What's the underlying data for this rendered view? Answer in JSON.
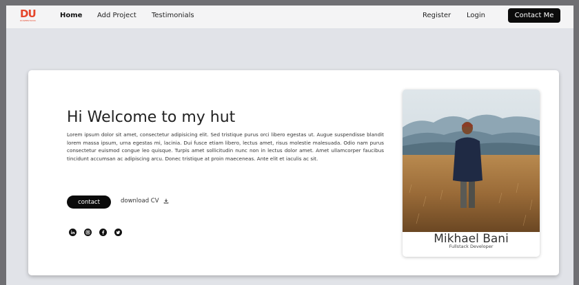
{
  "logo": {
    "letters": "DU",
    "subtitle": "DUWEBSTUDIO"
  },
  "nav": {
    "links": [
      "Home",
      "Add Project",
      "Testimonials"
    ],
    "register": "Register",
    "login": "Login",
    "cta": "Contact Me"
  },
  "hero": {
    "title": "Hi Welcome to my hut",
    "paragraph": "Lorem ipsum dolor sit amet, consectetur adipisicing elit. Sed tristique purus orci libero egestas ut. Augue suspendisse blandit lorem massa ipsum, urna egestas mi, lacinia. Dui fusce etiam libero, lectus amet, risus molestie malesuada. Odio nam purus consectetur euismod congue leo quisque. Turpis amet sollicitudin nunc non in lectus dolor amet. Amet ullamcorper faucibus tincidunt accumsan ac adipiscing arcu. Donec tristique at proin maeceneas. Ante elit et iaculis ac sit.",
    "contact_label": "contact",
    "download_label": "download CV"
  },
  "social": [
    "linkedin-icon",
    "instagram-icon",
    "facebook-icon",
    "twitter-icon"
  ],
  "profile": {
    "name": "Mikhael Bani",
    "role": "Fullstack Developer"
  },
  "colors": {
    "brand": "#e5462b",
    "button": "#0b0b0b",
    "page_bg": "#e1e3e8"
  }
}
